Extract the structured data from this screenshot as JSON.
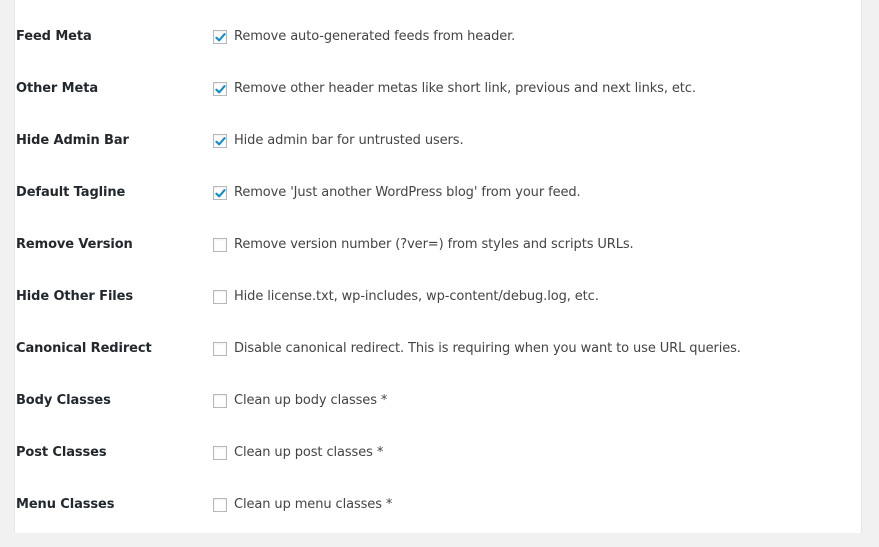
{
  "settings": {
    "accent_color": "#1e8cbe",
    "rows": [
      {
        "label": "Feed Meta",
        "description": "Remove auto-generated feeds from header.",
        "checked": true
      },
      {
        "label": "Other Meta",
        "description": "Remove other header metas like short link, previous and next links, etc.",
        "checked": true
      },
      {
        "label": "Hide Admin Bar",
        "description": "Hide admin bar for untrusted users.",
        "checked": true
      },
      {
        "label": "Default Tagline",
        "description": "Remove 'Just another WordPress blog' from your feed.",
        "checked": true
      },
      {
        "label": "Remove Version",
        "description": "Remove version number (?ver=) from styles and scripts URLs.",
        "checked": false
      },
      {
        "label": "Hide Other Files",
        "description": "Hide license.txt, wp-includes, wp-content/debug.log, etc.",
        "checked": false
      },
      {
        "label": "Canonical Redirect",
        "description": "Disable canonical redirect. This is requiring when you want to use URL queries.",
        "checked": false
      },
      {
        "label": "Body Classes",
        "description": "Clean up body classes *",
        "checked": false
      },
      {
        "label": "Post Classes",
        "description": "Clean up post classes *",
        "checked": false
      },
      {
        "label": "Menu Classes",
        "description": "Clean up menu classes *",
        "checked": false
      }
    ]
  }
}
